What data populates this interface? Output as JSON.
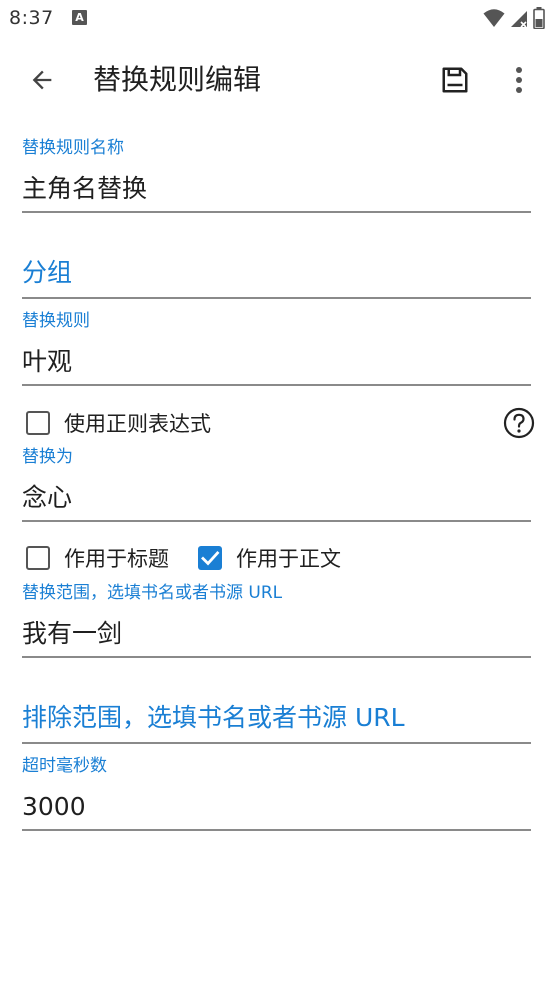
{
  "status_bar": {
    "time": "8:37",
    "notification_icon": "A"
  },
  "app_bar": {
    "title": "替换规则编辑"
  },
  "fields": {
    "rule_name": {
      "label": "替换规则名称",
      "value": "主角名替换"
    },
    "group": {
      "placeholder": "分组"
    },
    "pattern": {
      "label": "替换规则",
      "value": "叶观"
    },
    "replacement": {
      "label": "替换为",
      "value": "念心"
    },
    "scope": {
      "label": "替换范围，选填书名或者书源 URL",
      "value": "我有一剑"
    },
    "exclude_scope": {
      "placeholder": "排除范围，选填书名或者书源 URL"
    },
    "timeout": {
      "label": "超时毫秒数",
      "value": "3000"
    }
  },
  "checkboxes": {
    "use_regex": {
      "label": "使用正则表达式",
      "checked": false
    },
    "apply_title": {
      "label": "作用于标题",
      "checked": false
    },
    "apply_content": {
      "label": "作用于正文",
      "checked": true
    }
  },
  "icons": {
    "back": "arrow-back-icon",
    "save": "save-icon",
    "more": "more-vert-icon",
    "help": "help-circle-icon",
    "wifi": "wifi-icon",
    "signal": "signal-icon",
    "battery": "battery-icon"
  },
  "colors": {
    "accent": "#1a7fd4",
    "text": "#1f1f1f",
    "underline": "#8a8a8a"
  }
}
